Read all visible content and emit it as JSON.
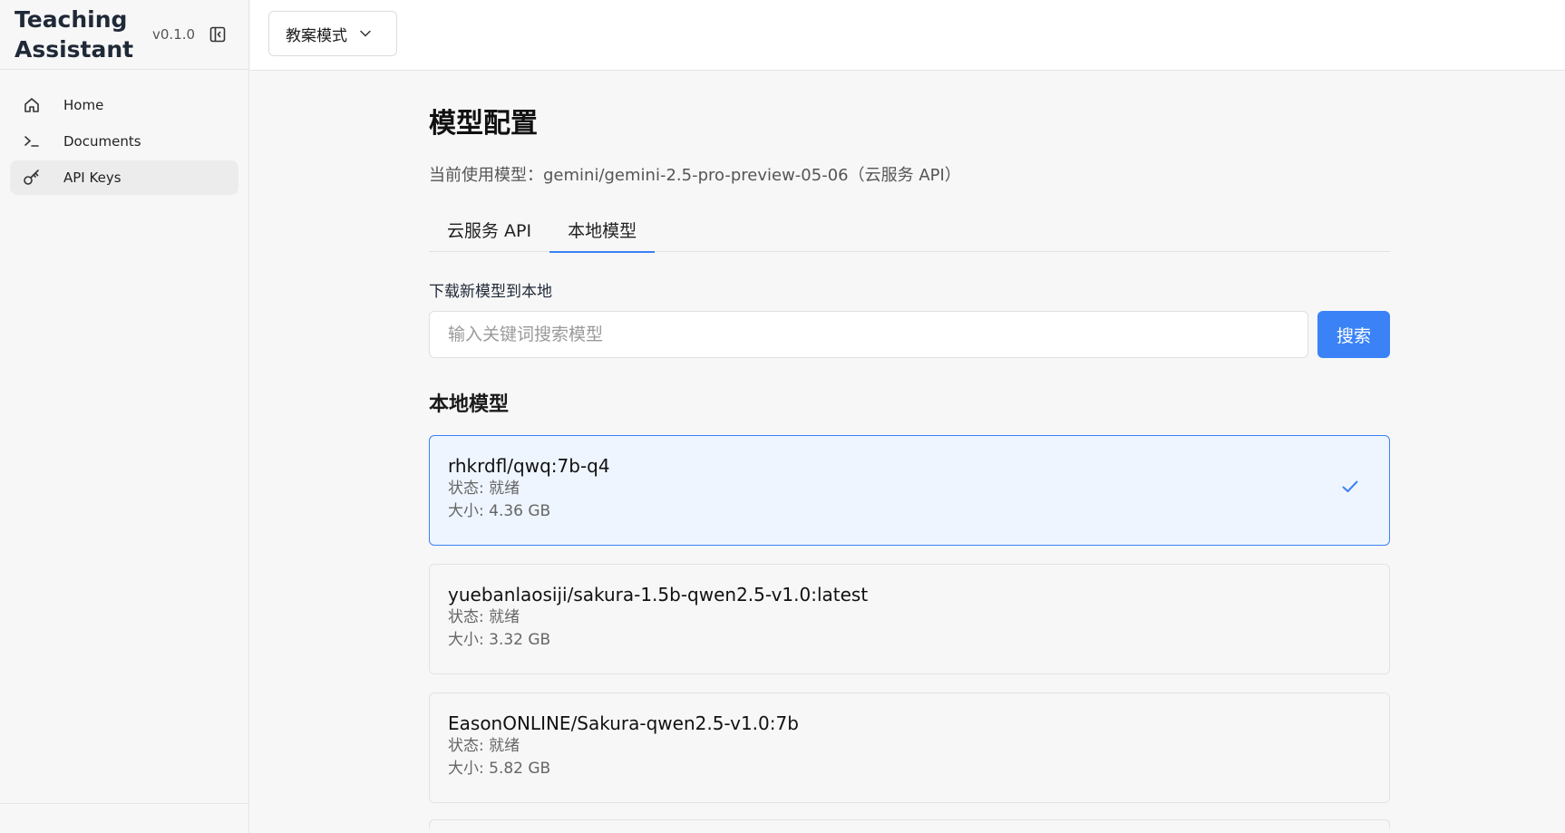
{
  "app": {
    "title": "Teaching Assistant",
    "version": "v0.1.0"
  },
  "sidebar": {
    "items": [
      {
        "label": "Home",
        "icon": "home-icon",
        "active": false
      },
      {
        "label": "Documents",
        "icon": "terminal-icon",
        "active": false
      },
      {
        "label": "API Keys",
        "icon": "key-icon",
        "active": true
      }
    ]
  },
  "topbar": {
    "mode_label": "教案模式"
  },
  "main": {
    "title": "模型配置",
    "current_model": "当前使用模型：gemini/gemini-2.5-pro-preview-05-06（云服务 API）",
    "tabs": [
      {
        "label": "云服务 API",
        "active": false
      },
      {
        "label": "本地模型",
        "active": true
      }
    ],
    "download_label": "下载新模型到本地",
    "search": {
      "placeholder": "输入关键词搜索模型",
      "button_label": "搜索"
    },
    "local_heading": "本地模型",
    "models": [
      {
        "name": "rhkrdfl/qwq:7b-q4",
        "status": "状态: 就绪",
        "size": "大小: 4.36 GB",
        "selected": true
      },
      {
        "name": "yuebanlaosiji/sakura-1.5b-qwen2.5-v1.0:latest",
        "status": "状态: 就绪",
        "size": "大小: 3.32 GB",
        "selected": false
      },
      {
        "name": "EasonONLINE/Sakura-qwen2.5-v1.0:7b",
        "status": "状态: 就绪",
        "size": "大小: 5.82 GB",
        "selected": false
      }
    ]
  },
  "colors": {
    "accent": "#3b82f6",
    "selected_bg": "#eef5ff"
  }
}
